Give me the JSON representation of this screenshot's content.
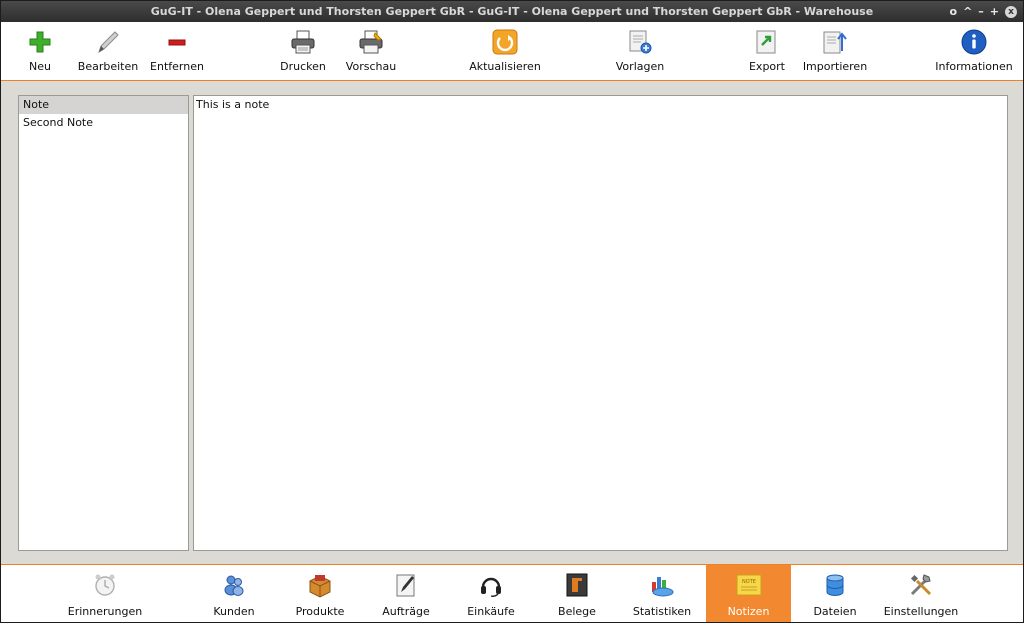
{
  "window": {
    "title": "GuG-IT - Olena Geppert und Thorsten Geppert GbR - GuG-IT - Olena Geppert und Thorsten Geppert GbR - Warehouse",
    "controls": [
      "o",
      "^",
      "–",
      "+",
      "x"
    ]
  },
  "toolbar": {
    "new_label": "Neu",
    "edit_label": "Bearbeiten",
    "remove_label": "Entfernen",
    "print_label": "Drucken",
    "preview_label": "Vorschau",
    "refresh_label": "Aktualisieren",
    "templates_label": "Vorlagen",
    "export_label": "Export",
    "import_label": "Importieren",
    "info_label": "Informationen"
  },
  "notes": {
    "items": [
      "Note",
      "Second Note"
    ],
    "selected": "Note",
    "content": "This is a note"
  },
  "modules": {
    "reminders": "Erinnerungen",
    "customers": "Kunden",
    "products": "Produkte",
    "orders": "Aufträge",
    "purchases": "Einkäufe",
    "receipts": "Belege",
    "statistics": "Statistiken",
    "notes": "Notizen",
    "files": "Dateien",
    "settings": "Einstellungen",
    "notes_icon_text": "NOTE",
    "active": "Notizen"
  },
  "colors": {
    "accent": "#f2882f",
    "titlebar": "#3a3a3a",
    "background": "#dcdad5"
  }
}
